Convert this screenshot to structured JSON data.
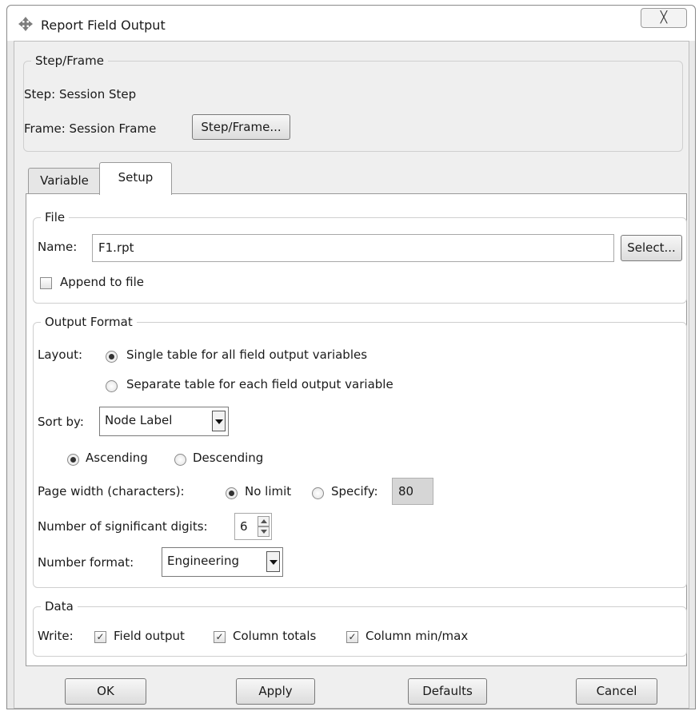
{
  "window": {
    "title": "Report Field Output",
    "icon": "move-cross-icon",
    "close_glyph": "╳"
  },
  "step_frame": {
    "group_label": "Step/Frame",
    "step_text": "Step: Session Step",
    "frame_text": "Frame:  Session Frame",
    "button_label": "Step/Frame..."
  },
  "tabs": [
    {
      "label": "Variable",
      "active": false
    },
    {
      "label": "Setup",
      "active": true
    }
  ],
  "file": {
    "group_label": "File",
    "name_label": "Name:",
    "name_value": "F1.rpt",
    "select_label": "Select...",
    "append_label": "Append to file",
    "append_checked": false
  },
  "output_format": {
    "group_label": "Output Format",
    "layout_label": "Layout:",
    "layout_options": [
      {
        "label": "Single table for all field output variables",
        "selected": true
      },
      {
        "label": "Separate table for each field output variable",
        "selected": false
      }
    ],
    "sort_label": "Sort by:",
    "sort_value": "Node Label",
    "order_options": [
      {
        "label": "Ascending",
        "selected": true
      },
      {
        "label": "Descending",
        "selected": false
      }
    ],
    "page_width_label": "Page width (characters):",
    "page_width_options": [
      {
        "label": "No limit",
        "selected": true
      },
      {
        "label": "Specify:",
        "selected": false
      }
    ],
    "page_width_value": "80",
    "digits_label": "Number of significant digits:",
    "digits_value": "6",
    "number_format_label": "Number format:",
    "number_format_value": "Engineering"
  },
  "data": {
    "group_label": "Data",
    "write_label": "Write:",
    "options": [
      {
        "label": "Field output",
        "checked": true
      },
      {
        "label": "Column totals",
        "checked": true
      },
      {
        "label": "Column min/max",
        "checked": true
      }
    ]
  },
  "buttons": {
    "ok": "OK",
    "apply": "Apply",
    "defaults": "Defaults",
    "cancel": "Cancel"
  },
  "check_glyph": "✓"
}
